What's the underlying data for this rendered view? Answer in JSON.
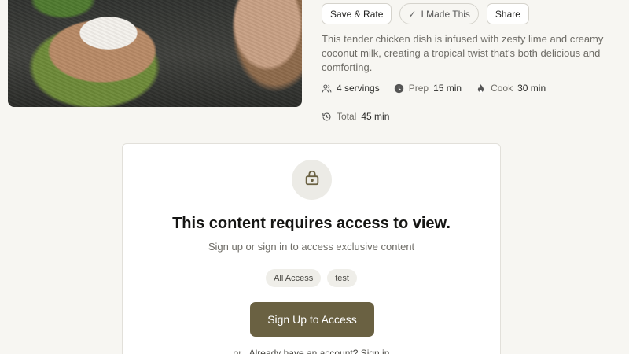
{
  "actions": {
    "save_rate": "Save & Rate",
    "made_this": "I Made This",
    "share": "Share"
  },
  "description": "This tender chicken dish is infused with zesty lime and creamy coconut milk, creating a tropical twist that's both delicious and comforting.",
  "meta": {
    "servings": "4 servings",
    "prep_label": "Prep",
    "prep_value": "15 min",
    "cook_label": "Cook",
    "cook_value": "30 min",
    "total_label": "Total",
    "total_value": "45 min"
  },
  "access": {
    "title": "This content requires access to view.",
    "subtitle": "Sign up or sign in to access exclusive content",
    "tags": [
      "All Access",
      "test"
    ],
    "signup_label": "Sign Up to Access",
    "or_text": "or",
    "signin_text": "Already have an account? Sign in"
  },
  "icons": {
    "servings": "users-icon",
    "prep": "clock-icon",
    "cook": "flame-icon",
    "total": "history-icon",
    "lock": "lock-icon",
    "check": "check-icon"
  },
  "colors": {
    "accent": "#6a6142",
    "background": "#f7f6f2"
  }
}
